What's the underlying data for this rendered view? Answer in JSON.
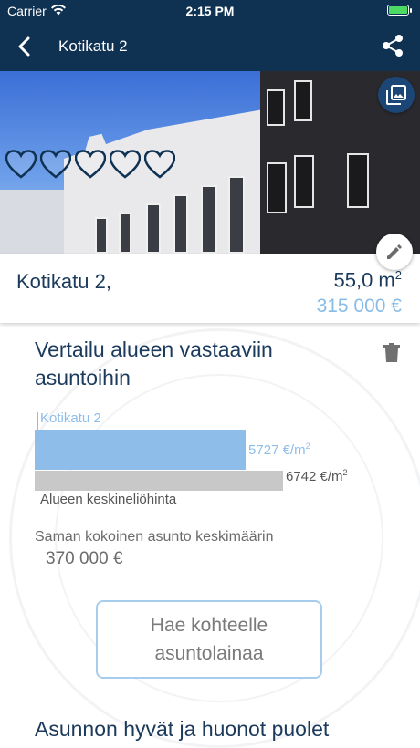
{
  "status_bar": {
    "carrier": "Carrier",
    "time": "2:15 PM"
  },
  "nav": {
    "title": "Kotikatu 2"
  },
  "hero": {
    "favorite_hearts": 5
  },
  "listing": {
    "address": "Kotikatu 2,",
    "area": "55,0 m",
    "area_unit_sup": "2",
    "price": "315 000 €"
  },
  "comparison": {
    "title": "Vertailu alueen vastaaviin asuntoihin",
    "chart_data": {
      "type": "bar",
      "orientation": "horizontal",
      "categories": [
        "Kotikatu 2",
        "Alueen keskineliöhinta"
      ],
      "values": [
        5727,
        6742
      ],
      "value_labels": [
        "5727 €/m",
        "6742 €/m"
      ],
      "unit_sup": "2",
      "colors": [
        "#8ebde9",
        "#c8c8c8"
      ]
    },
    "avg_label": "Saman kokoinen asunto keskimäärin",
    "avg_value": "370 000 €"
  },
  "loan_button": {
    "line1": "Hae kohteelle",
    "line2": "asuntolainaa"
  },
  "pros_cons": {
    "title": "Asunnon hyvät ja huonot puolet"
  }
}
